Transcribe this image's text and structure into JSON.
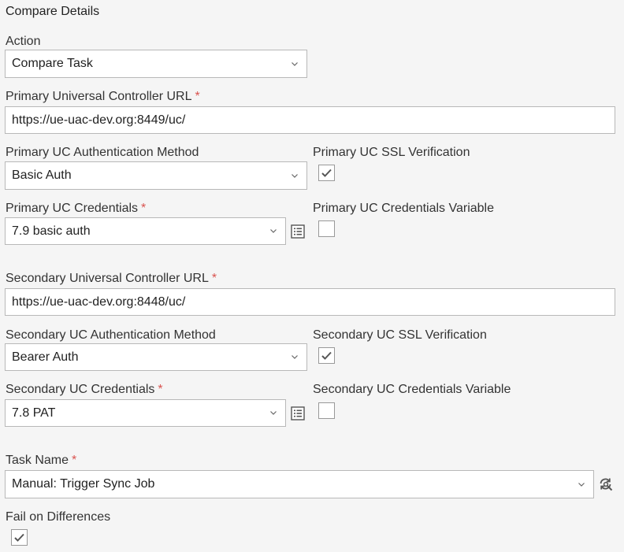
{
  "section_title": "Compare Details",
  "required_mark": "*",
  "action": {
    "label": "Action",
    "value": "Compare Task"
  },
  "primary": {
    "url_label": "Primary Universal Controller URL",
    "url_value": "https://ue-uac-dev.org:8449/uc/",
    "auth_label": "Primary UC Authentication Method",
    "auth_value": "Basic Auth",
    "ssl_label": "Primary UC SSL Verification",
    "ssl_checked": true,
    "cred_label": "Primary UC Credentials",
    "cred_value": "7.9 basic auth",
    "cred_var_label": "Primary UC Credentials Variable",
    "cred_var_checked": false
  },
  "secondary": {
    "url_label": "Secondary Universal Controller URL",
    "url_value": "https://ue-uac-dev.org:8448/uc/",
    "auth_label": "Secondary UC Authentication Method",
    "auth_value": "Bearer Auth",
    "ssl_label": "Secondary UC SSL Verification",
    "ssl_checked": true,
    "cred_label": "Secondary UC Credentials",
    "cred_value": "7.8 PAT",
    "cred_var_label": "Secondary UC Credentials Variable",
    "cred_var_checked": false
  },
  "task": {
    "label": "Task Name",
    "value": "Manual: Trigger Sync Job"
  },
  "fail_on_diff": {
    "label": "Fail on Differences",
    "checked": true
  },
  "icons": {
    "dropdown": "chevron-down-icon",
    "list": "list-icon",
    "refresh_search": "refresh-search-icon",
    "check": "checkmark-icon"
  },
  "colors": {
    "required": "#d9534f",
    "border": "#b8b8b8",
    "background": "#f5f5f5"
  }
}
